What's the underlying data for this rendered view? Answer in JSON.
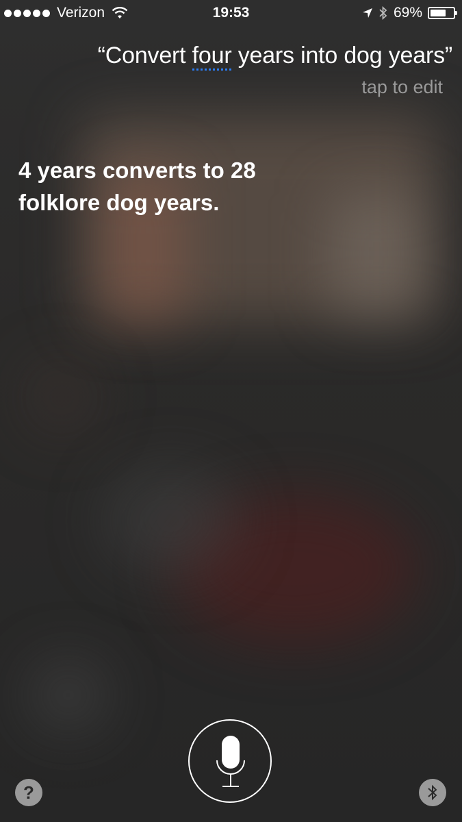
{
  "status_bar": {
    "signal_bars": 5,
    "carrier": "Verizon",
    "time": "19:53",
    "battery_percent": "69%",
    "battery_level": 0.69,
    "icons": [
      "signal-dots-icon",
      "wifi-icon",
      "location-arrow-icon",
      "bluetooth-icon",
      "battery-icon"
    ]
  },
  "siri": {
    "query_open_quote": "“",
    "query_before": "Convert ",
    "query_flagged": "four",
    "query_after": " years into dog years",
    "query_close_quote": "”",
    "tap_to_edit": "tap to edit",
    "answer": "4 years converts to 28 folklore dog years."
  },
  "controls": {
    "help_label": "?",
    "mic_icon": "microphone-icon",
    "bluetooth_icon": "bluetooth-icon"
  },
  "colors": {
    "background": "#2a2a2a",
    "flag_underline": "#2b7df5",
    "secondary_text": "#9a9a9a",
    "button_gray": "#9a9a9a"
  }
}
